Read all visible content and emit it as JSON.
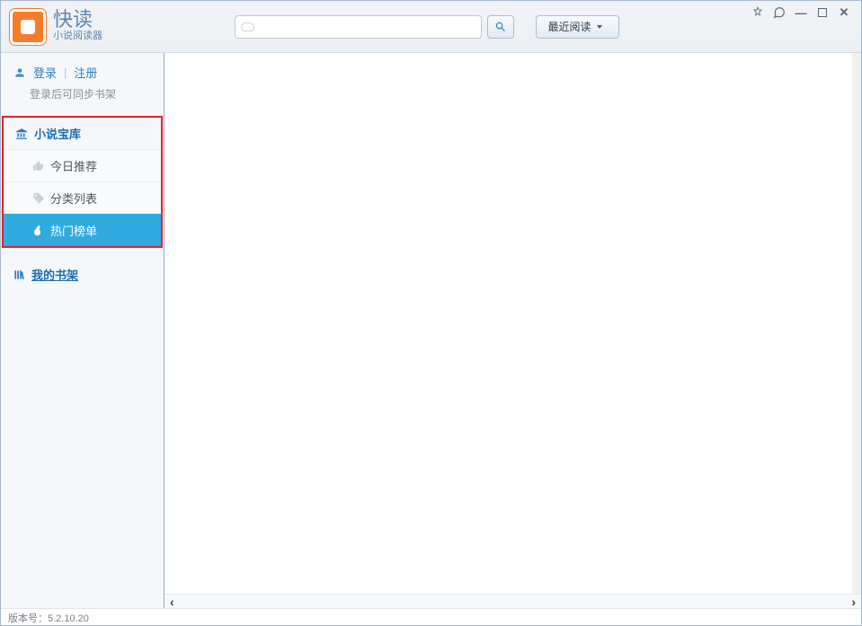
{
  "header": {
    "app_title": "快读",
    "app_subtitle": "小说阅读器",
    "search_placeholder": "",
    "recent_label": "最近阅读"
  },
  "window_controls": {
    "feedback": "feedback-icon",
    "chat": "chat-icon",
    "minimize": "minimize",
    "maximize": "maximize",
    "close": "close"
  },
  "sidebar": {
    "login_label": "登录",
    "register_label": "注册",
    "login_hint": "登录后可同步书架",
    "sections": [
      {
        "title": "小说宝库",
        "items": [
          {
            "label": "今日推荐",
            "icon": "thumb-icon",
            "active": false
          },
          {
            "label": "分类列表",
            "icon": "tag-icon",
            "active": false
          },
          {
            "label": "热门榜单",
            "icon": "fire-icon",
            "active": true
          }
        ]
      },
      {
        "title": "我的书架",
        "items": []
      }
    ]
  },
  "status_bar": {
    "version_label": "版本号：",
    "version_value": "5.2.10.20"
  }
}
